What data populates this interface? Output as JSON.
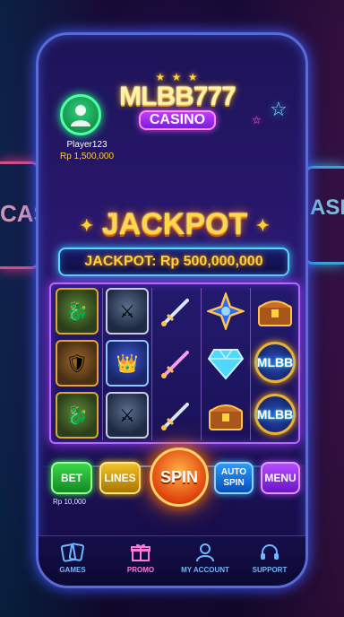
{
  "background": {
    "left_sign": "CASI",
    "right_sign": "ASINO"
  },
  "logo": {
    "title": "MLBB777",
    "subtitle": "CASINO",
    "stars": "★ ★ ★"
  },
  "player": {
    "name": "Player123",
    "balance": "Rp 1,500,000"
  },
  "jackpot": {
    "title": "JACKPOT",
    "bar_text": "JACKPOT: Rp 500,000,000"
  },
  "reels": {
    "mlbb_symbol_text": "MLBB",
    "columns": [
      [
        "dragon-symbol",
        "hero-warrior-symbol",
        "dragon-symbol"
      ],
      [
        "knight-symbol",
        "hero-mage-symbol",
        "knight-symbol"
      ],
      [
        "sword-symbol",
        "sword-symbol",
        "sword-symbol"
      ],
      [
        "star-emblem-symbol",
        "diamond-symbol",
        "treasure-chest-symbol"
      ],
      [
        "treasure-chest-symbol",
        "mlbb-coin-symbol",
        "mlbb-coin-symbol"
      ]
    ]
  },
  "controls": {
    "bet_label": "BET",
    "lines_label": "LINES",
    "spin_label": "SPIN",
    "auto_spin_label_1": "AUTO",
    "auto_spin_label_2": "SPIN",
    "menu_label": "MENU",
    "bet_amount": "Rp 10,000"
  },
  "nav": {
    "games": "GAMES",
    "promo": "PROMO",
    "account": "MY ACCOUNT",
    "support": "SUPPORT"
  },
  "colors": {
    "accent_gold": "#ffd23a",
    "neon_blue": "#38c8ff",
    "neon_purple": "#b06aff",
    "spin_orange": "#e0420c"
  }
}
